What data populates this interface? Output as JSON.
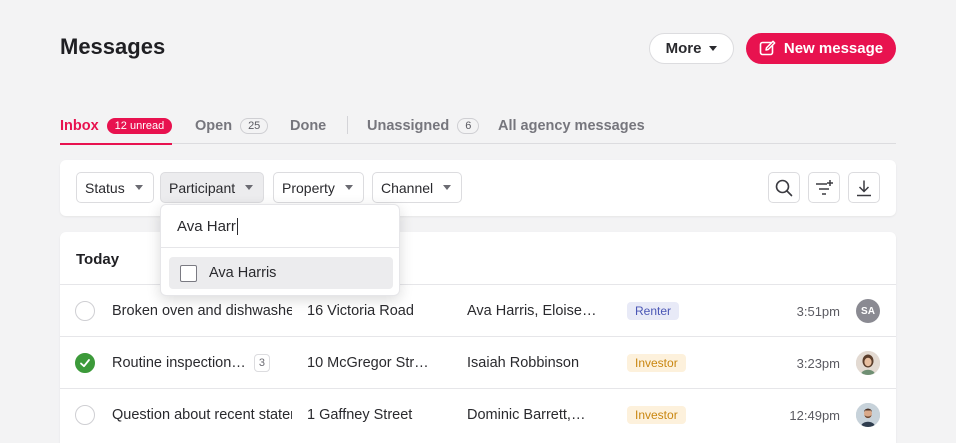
{
  "header": {
    "title": "Messages",
    "more_label": "More",
    "new_message_label": "New message"
  },
  "tabs": [
    {
      "label": "Inbox",
      "badge": "12 unread",
      "active": true
    },
    {
      "label": "Open",
      "badge": "25"
    },
    {
      "label": "Done"
    },
    {
      "label": "Unassigned",
      "badge": "6"
    },
    {
      "label": "All agency messages"
    }
  ],
  "filters": {
    "status": "Status",
    "participant": "Participant",
    "property": "Property",
    "channel": "Channel"
  },
  "participant_dropdown": {
    "query": "Ava Harr",
    "options": [
      {
        "label": "Ava Harris",
        "checked": false
      }
    ]
  },
  "list": {
    "section_title": "Today",
    "rows": [
      {
        "subject": "Broken oven and dishwasher",
        "count": "",
        "address": "16 Victoria Road",
        "participants": "Ava Harris, Eloise…",
        "role": "Renter",
        "time": "3:51pm",
        "avatar": "SA",
        "done": false
      },
      {
        "subject": "Routine inspection…",
        "count": "3",
        "address": "10 McGregor Str…",
        "participants": "Isaiah Robbinson",
        "role": "Investor",
        "time": "3:23pm",
        "avatar": "",
        "done": true
      },
      {
        "subject": "Question about recent statement",
        "count": "",
        "address": "1 Gaffney Street",
        "participants": "Dominic Barrett,…",
        "role": "Investor",
        "time": "12:49pm",
        "avatar": "",
        "done": false
      }
    ]
  },
  "colors": {
    "accent": "#e8124f",
    "done_green": "#3c9a3a",
    "renter_badge": "#4a56b5",
    "investor_badge": "#c98610"
  },
  "icons": [
    "caret-down-icon",
    "edit-icon",
    "search-icon",
    "filter-add-icon",
    "download-icon",
    "check-icon"
  ]
}
